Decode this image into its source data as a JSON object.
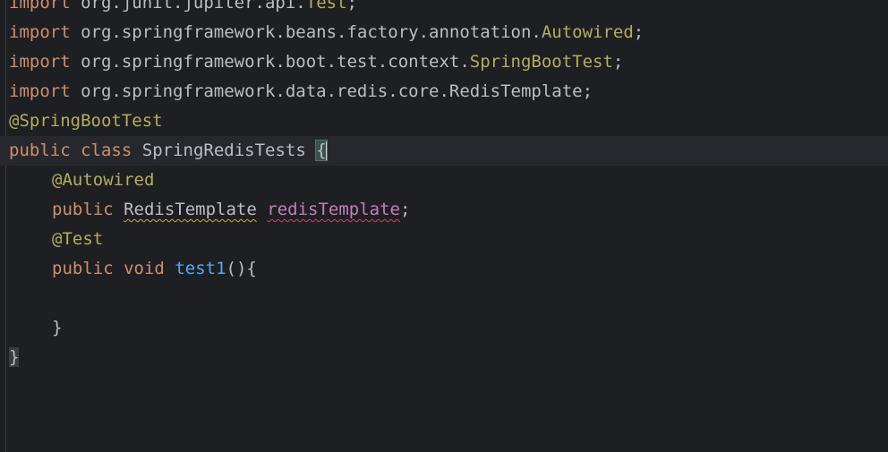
{
  "code": {
    "line1": {
      "kw": "import",
      "pkg": " org.junit.jupiter.api.",
      "cls": "Test",
      "end": ";"
    },
    "line2": {
      "kw": "import",
      "pkg": " org.springframework.beans.factory.annotation.",
      "cls": "Autowired",
      "end": ";"
    },
    "line3": {
      "kw": "import",
      "pkg": " org.springframework.boot.test.context.",
      "cls": "SpringBootTest",
      "end": ";"
    },
    "line4": {
      "kw": "import",
      "pkg": " org.springframework.data.redis.core.RedisTemplate",
      "end": ";"
    },
    "line5": {
      "ann": "@SpringBootTest"
    },
    "line6": {
      "kw1": "public",
      "kw2": "class",
      "cls": "SpringRedisTests",
      "brace": "{"
    },
    "line7": {
      "ann": "@Autowired"
    },
    "line8": {
      "kw": "public",
      "type": "RedisTemplate",
      "field": "redisTemplate",
      "end": ";"
    },
    "line9": {
      "ann": "@Test"
    },
    "line10": {
      "kw1": "public",
      "kw2": "void",
      "fn": "test1",
      "rest": "(){"
    },
    "line11": {
      "text": ""
    },
    "line12": {
      "brace": "}"
    },
    "line13": {
      "brace": "}"
    }
  }
}
